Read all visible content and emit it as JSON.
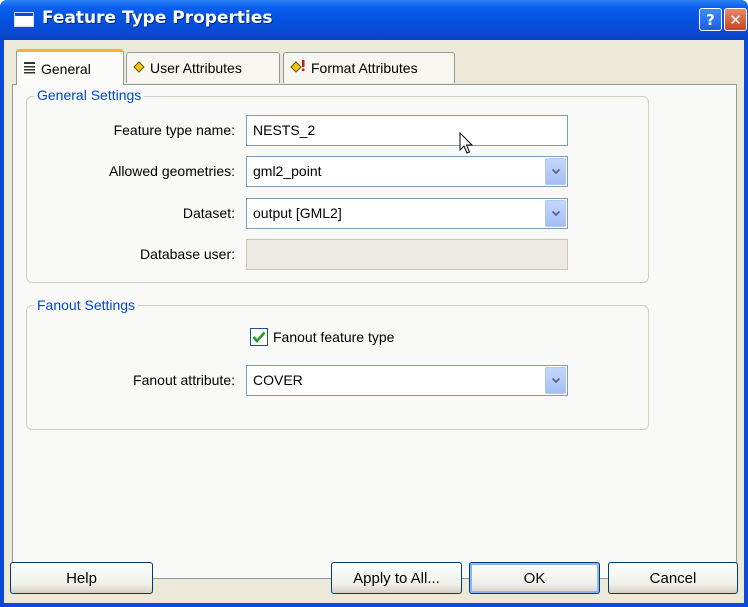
{
  "window": {
    "title": "Feature Type Properties",
    "help_glyph": "?",
    "close_glyph": "✕"
  },
  "tabs": [
    {
      "label": "General",
      "icon": "list-icon",
      "active": true
    },
    {
      "label": "User Attributes",
      "icon": "diamond-icon",
      "active": false
    },
    {
      "label": "Format Attributes",
      "icon": "diamond-exclamation-icon",
      "active": false
    }
  ],
  "general_settings": {
    "legend": "General Settings",
    "feature_type_name": {
      "label": "Feature type name:",
      "value": "NESTS_2"
    },
    "allowed_geometries": {
      "label": "Allowed geometries:",
      "value": "gml2_point"
    },
    "dataset": {
      "label": "Dataset:",
      "value": "output [GML2]"
    },
    "database_user": {
      "label": "Database user:",
      "value": ""
    }
  },
  "fanout_settings": {
    "legend": "Fanout Settings",
    "fanout_feature_type": {
      "label": "Fanout feature type",
      "checked": true
    },
    "fanout_attribute": {
      "label": "Fanout attribute:",
      "value": "COVER"
    }
  },
  "buttons": {
    "help": "Help",
    "apply_to_all": "Apply to All...",
    "ok": "OK",
    "cancel": "Cancel"
  },
  "colors": {
    "titlebar": "#0a4ad8",
    "legend_text": "#0046d5",
    "active_tab_accent": "#f6b42d",
    "checkmark": "#21a121"
  }
}
